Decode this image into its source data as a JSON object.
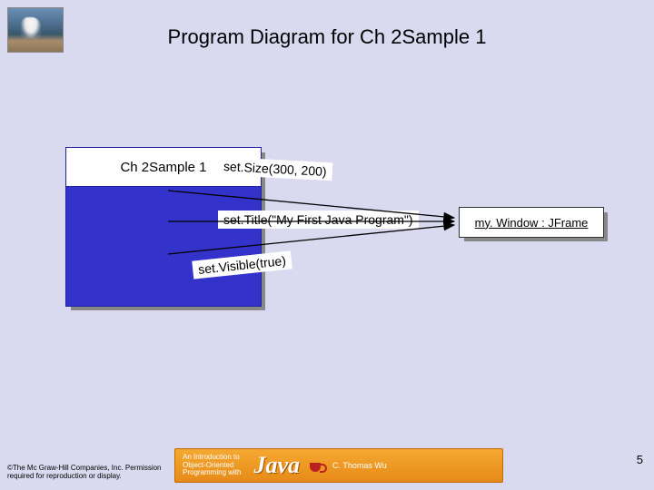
{
  "title": "Program Diagram for Ch 2Sample 1",
  "left_box_label": "Ch 2Sample 1",
  "calls": {
    "c1": "set.Size(300, 200)",
    "c2": "set.Title(\"My First Java Program\")",
    "c3": "set.Visible(true)"
  },
  "object_box": {
    "name": "my. Window",
    "type": "JFrame"
  },
  "footer": {
    "copyright": "©The Mc Graw-Hill Companies, Inc. Permission required for reproduction or display.",
    "banner_intro_l1": "An Introduction to",
    "banner_intro_l2": "Object-Oriented",
    "banner_intro_l3": "Programming with",
    "banner_word": "Java",
    "banner_author": "C. Thomas Wu",
    "page": "5"
  }
}
